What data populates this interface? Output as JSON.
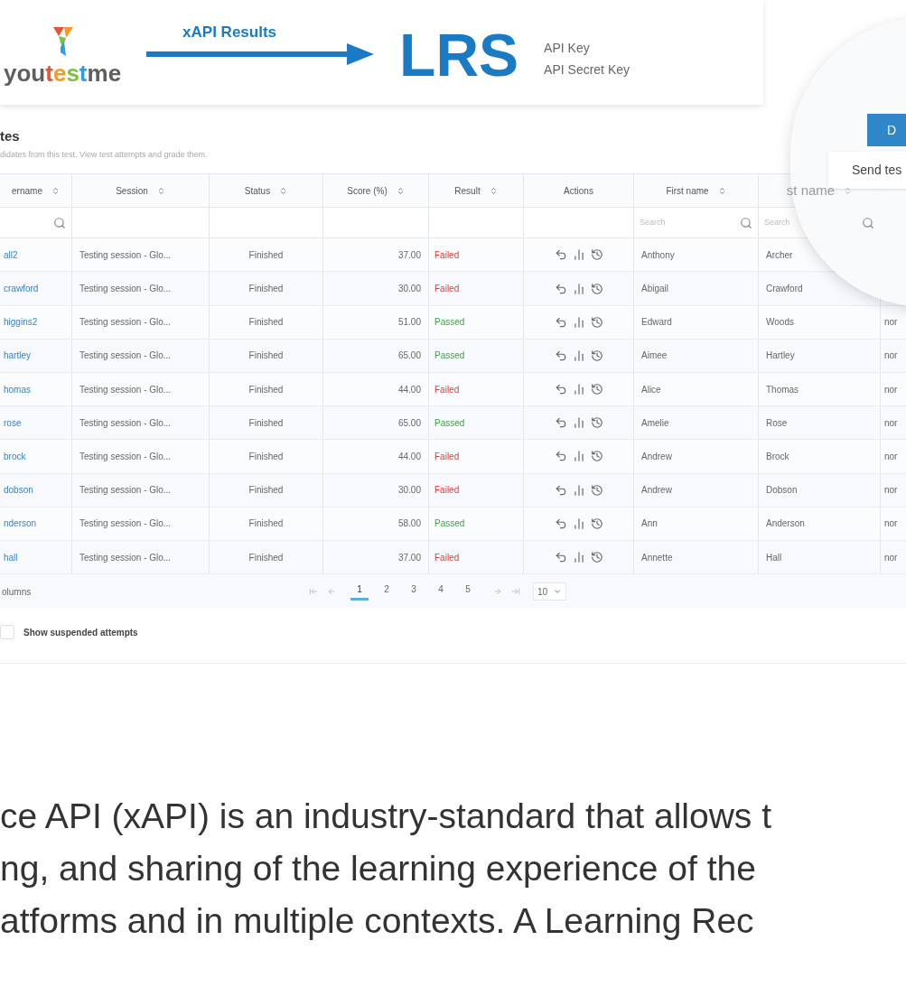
{
  "banner": {
    "logo_text": [
      {
        "text": "you",
        "color": "#5f5f5f"
      },
      {
        "text": "t",
        "color": "#e8542f"
      },
      {
        "text": "e",
        "color": "#f59a23"
      },
      {
        "text": "s",
        "color": "#7cc242"
      },
      {
        "text": "t",
        "color": "#2d9ee0"
      },
      {
        "text": "me",
        "color": "#5f5f5f"
      }
    ],
    "arrow_label": "xAPI Results",
    "target": "LRS",
    "keys": [
      "API Key",
      "API Secret Key"
    ]
  },
  "panel": {
    "title": "tes",
    "subtitle": "didates from this test. View test attempts and grade them.",
    "columns": [
      {
        "label": "ername",
        "sortable": true
      },
      {
        "label": "Session",
        "sortable": true
      },
      {
        "label": "Status",
        "sortable": true
      },
      {
        "label": "Score (%)",
        "sortable": true
      },
      {
        "label": "Result",
        "sortable": true
      },
      {
        "label": "Actions",
        "sortable": false
      },
      {
        "label": "First name",
        "sortable": true
      },
      {
        "label": "st name",
        "sortable": true
      }
    ],
    "search_placeholders": [
      "Search",
      "Search"
    ],
    "rows": [
      {
        "username": "all2",
        "session": "Testing session - Glo...",
        "status": "Finished",
        "score": "37.00",
        "result": "Failed",
        "kind": "failed",
        "first": "Anthony",
        "last": "Archer",
        "column_9": ""
      },
      {
        "username": "crawford",
        "session": "Testing session - Glo...",
        "status": "Finished",
        "score": "30.00",
        "result": "Failed",
        "kind": "failed",
        "first": "Abigail",
        "last": "Crawford",
        "column_9": ""
      },
      {
        "username": "higgins2",
        "session": "Testing session - Glo...",
        "status": "Finished",
        "score": "51.00",
        "result": "Passed",
        "kind": "passed",
        "first": "Edward",
        "last": "Woods",
        "column_9": "nor"
      },
      {
        "username": "hartley",
        "session": "Testing session - Glo...",
        "status": "Finished",
        "score": "65.00",
        "result": "Passed",
        "kind": "passed",
        "first": "Aimee",
        "last": "Hartley",
        "column_9": "nor"
      },
      {
        "username": "homas",
        "session": "Testing session - Glo...",
        "status": "Finished",
        "score": "44.00",
        "result": "Failed",
        "kind": "failed",
        "first": "Alice",
        "last": "Thomas",
        "column_9": "nor"
      },
      {
        "username": "rose",
        "session": "Testing session - Glo...",
        "status": "Finished",
        "score": "65.00",
        "result": "Passed",
        "kind": "passed",
        "first": "Amelie",
        "last": "Rose",
        "column_9": "nor"
      },
      {
        "username": "brock",
        "session": "Testing session - Glo...",
        "status": "Finished",
        "score": "44.00",
        "result": "Failed",
        "kind": "failed",
        "first": "Andrew",
        "last": "Brock",
        "column_9": "nor"
      },
      {
        "username": "dobson",
        "session": "Testing session - Glo...",
        "status": "Finished",
        "score": "30.00",
        "result": "Failed",
        "kind": "failed",
        "first": "Andrew",
        "last": "Dobson",
        "column_9": "nor"
      },
      {
        "username": "nderson",
        "session": "Testing session - Glo...",
        "status": "Finished",
        "score": "58.00",
        "result": "Passed",
        "kind": "passed",
        "first": "Ann",
        "last": "Anderson",
        "column_9": "nor"
      },
      {
        "username": "hall",
        "session": "Testing session - Glo...",
        "status": "Finished",
        "score": "37.00",
        "result": "Failed",
        "kind": "failed",
        "first": "Annette",
        "last": "Hall",
        "column_9": "nor"
      }
    ],
    "footer_label": "olumns",
    "pages": [
      {
        "label": "1",
        "selected": true
      },
      {
        "label": "2",
        "selected": false
      },
      {
        "label": "3",
        "selected": false
      },
      {
        "label": "4",
        "selected": false
      },
      {
        "label": "5",
        "selected": false
      }
    ],
    "page_size": "10",
    "show_suspended": {
      "label": "Show suspended attempts",
      "checked": false
    },
    "zoom_button": "D",
    "zoom_menu_item": "Send tes"
  },
  "paragraph_lines": [
    "ce API (xAPI) is an industry-standard that allows t",
    "ng, and sharing of the learning experience of the",
    "atforms and in multiple contexts. A Learning Rec"
  ]
}
